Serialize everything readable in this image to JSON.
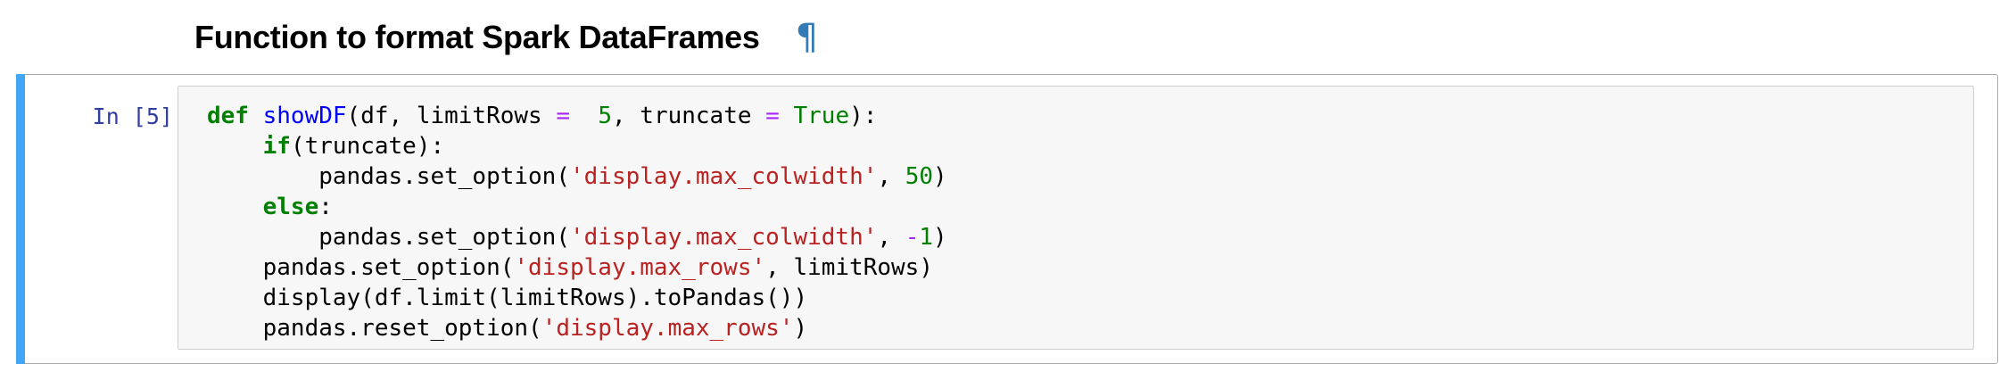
{
  "heading": {
    "title": "Function to format Spark DataFrames",
    "anchor": "¶"
  },
  "cell": {
    "prompt": "In [5]:",
    "code_lines": [
      [
        {
          "t": "def",
          "c": "kw"
        },
        {
          "t": " "
        },
        {
          "t": "showDF",
          "c": "fn"
        },
        {
          "t": "(df, limitRows "
        },
        {
          "t": "=",
          "c": "op"
        },
        {
          "t": "  "
        },
        {
          "t": "5",
          "c": "num"
        },
        {
          "t": ", truncate "
        },
        {
          "t": "=",
          "c": "op"
        },
        {
          "t": " "
        },
        {
          "t": "True",
          "c": "const"
        },
        {
          "t": "):"
        }
      ],
      [
        {
          "t": "    "
        },
        {
          "t": "if",
          "c": "kw"
        },
        {
          "t": "(truncate):"
        }
      ],
      [
        {
          "t": "        pandas.set_option("
        },
        {
          "t": "'display.max_colwidth'",
          "c": "str"
        },
        {
          "t": ", "
        },
        {
          "t": "50",
          "c": "num"
        },
        {
          "t": ")"
        }
      ],
      [
        {
          "t": "    "
        },
        {
          "t": "else",
          "c": "kw"
        },
        {
          "t": ":"
        }
      ],
      [
        {
          "t": "        pandas.set_option("
        },
        {
          "t": "'display.max_colwidth'",
          "c": "str"
        },
        {
          "t": ", "
        },
        {
          "t": "-",
          "c": "op"
        },
        {
          "t": "1",
          "c": "num"
        },
        {
          "t": ")"
        }
      ],
      [
        {
          "t": "    pandas.set_option("
        },
        {
          "t": "'display.max_rows'",
          "c": "str"
        },
        {
          "t": ", limitRows)"
        }
      ],
      [
        {
          "t": "    display(df.limit(limitRows).toPandas())"
        }
      ],
      [
        {
          "t": "    pandas.reset_option("
        },
        {
          "t": "'display.max_rows'",
          "c": "str"
        },
        {
          "t": ")"
        }
      ]
    ]
  },
  "colors": {
    "selected_bar": "#42a5f5",
    "prompt": "#303f9f",
    "keyword": "#008000",
    "function": "#0000ff",
    "operator": "#aa22ff",
    "string": "#ba2121",
    "anchor": "#337ab7"
  }
}
